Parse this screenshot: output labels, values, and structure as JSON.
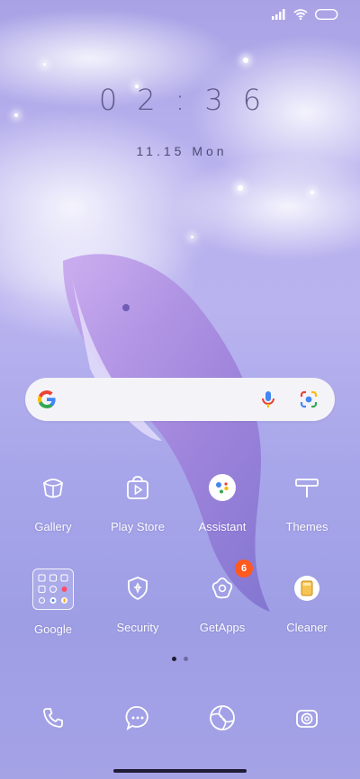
{
  "status": {
    "icons": [
      "signal-icon",
      "wifi-icon",
      "battery-icon"
    ]
  },
  "lockscreen": {
    "time": "02:36",
    "date": "11.15 Mon"
  },
  "search": {
    "icons": [
      "google-g-icon",
      "microphone-icon",
      "lens-icon"
    ]
  },
  "row1": [
    {
      "label": "Gallery",
      "icon": "gallery-icon"
    },
    {
      "label": "Play Store",
      "icon": "play-store-icon"
    },
    {
      "label": "Assistant",
      "icon": "assistant-icon"
    },
    {
      "label": "Themes",
      "icon": "themes-icon"
    }
  ],
  "row2": [
    {
      "label": "Google",
      "icon": "google-folder-icon"
    },
    {
      "label": "Security",
      "icon": "security-icon"
    },
    {
      "label": "GetApps",
      "icon": "getapps-icon",
      "badge": "6"
    },
    {
      "label": "Cleaner",
      "icon": "cleaner-icon"
    }
  ],
  "pages": {
    "current": 1,
    "total": 2
  },
  "dock": [
    {
      "icon": "phone-icon"
    },
    {
      "icon": "messages-icon"
    },
    {
      "icon": "browser-icon"
    },
    {
      "icon": "camera-icon"
    }
  ],
  "colors": {
    "badge": "#ff5a1f",
    "clock": "#5f5a8a"
  }
}
